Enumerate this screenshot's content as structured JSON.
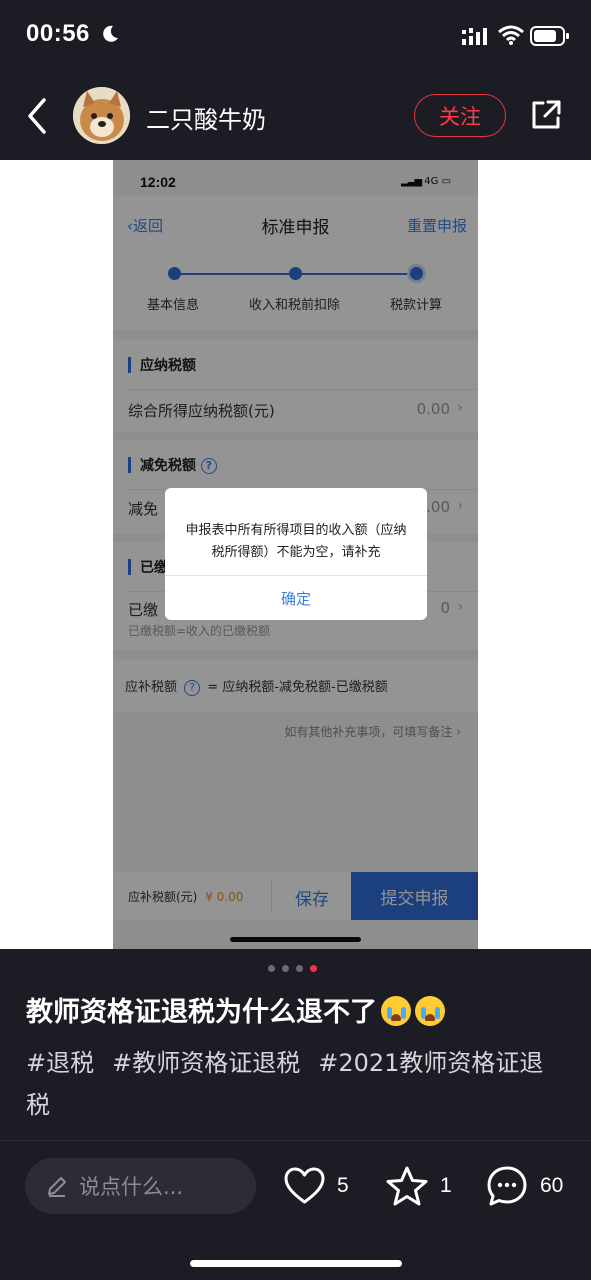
{
  "status_bar": {
    "time": "00:56"
  },
  "header": {
    "author_name": "二只酸牛奶",
    "follow_label": "关注"
  },
  "screenshot": {
    "time": "12:02",
    "network": "4G",
    "nav": {
      "back_label": "返回",
      "title": "标准申报",
      "reset_label": "重置申报"
    },
    "steps": [
      {
        "label": "基本信息"
      },
      {
        "label": "收入和税前扣除"
      },
      {
        "label": "税款计算"
      }
    ],
    "sections": {
      "payable": {
        "title": "应纳税额",
        "row_label": "综合所得应纳税额(元)",
        "row_value": "0.00"
      },
      "reduction": {
        "title": "减免税额",
        "row_label": "减免",
        "row_value": ".00"
      },
      "paid": {
        "title": "已缴",
        "row_label": "已缴",
        "row_value": "0",
        "row_note": "已缴税额=收入的已缴税额"
      }
    },
    "formula": {
      "label": "应补税额",
      "text": "= 应纳税额-减免税额-已缴税额"
    },
    "remark": "如有其他补充事项，可填写备注",
    "bottom": {
      "due_label": "应补税额(元)",
      "due_value": "¥ 0.00",
      "save_label": "保存",
      "submit_label": "提交申报"
    },
    "dialog": {
      "message": "申报表中所有所得项目的收入额（应纳税所得额）不能为空，请补充",
      "confirm_label": "确定"
    }
  },
  "pager": {
    "total": 4,
    "active_index": 3
  },
  "post": {
    "title": "教师资格证退税为什么退不了",
    "title_emojis": [
      "loudly-crying-face",
      "loudly-crying-face"
    ],
    "tags": [
      "#退税",
      "#教师资格证退税",
      "#2021教师资格证退税"
    ]
  },
  "bottom_bar": {
    "comment_placeholder": "说点什么...",
    "likes": "5",
    "favorites": "1",
    "comments": "60"
  },
  "colors": {
    "accent_red": "#e8323c",
    "app_bg": "#1c1c24",
    "screenshot_blue": "#2f6ed8"
  }
}
